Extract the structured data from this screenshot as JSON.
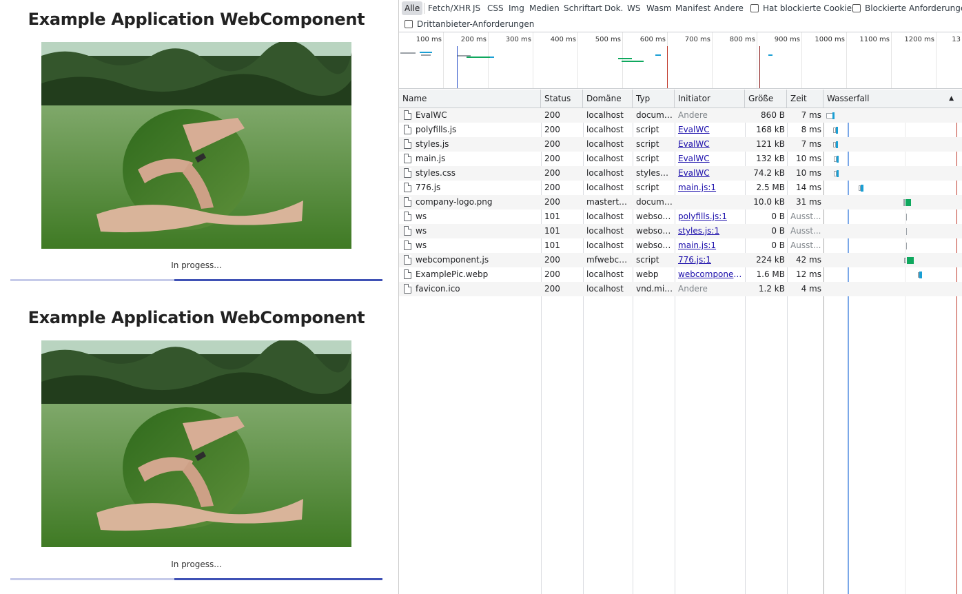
{
  "app_panels": [
    {
      "title": "Example Application WebComponent",
      "status": "In progess...",
      "progress": 0.44
    },
    {
      "title": "Example Application WebComponent",
      "status": "In progess...",
      "progress": 0.44
    }
  ],
  "filters": {
    "buttons": [
      "Alle",
      "Fetch/XHR",
      "JS",
      "CSS",
      "Img",
      "Medien",
      "Schriftart",
      "Dok.",
      "WS",
      "Wasm",
      "Manifest",
      "Andere"
    ],
    "active": "Alle",
    "checkboxes": [
      "Hat blockierte Cookies",
      "Blockierte Anforderungen",
      "Drittanbieter-Anforderungen"
    ]
  },
  "timeline": {
    "ticks": [
      "100 ms",
      "200 ms",
      "300 ms",
      "400 ms",
      "500 ms",
      "600 ms",
      "700 ms",
      "800 ms",
      "900 ms",
      "1000 ms",
      "1100 ms",
      "1200 ms",
      "13"
    ]
  },
  "columns": {
    "name": "Name",
    "status": "Status",
    "domain": "Domäne",
    "type": "Typ",
    "initiator": "Initiator",
    "size": "Größe",
    "time": "Zeit",
    "waterfall": "Wasserfall",
    "sort_icon": "▲"
  },
  "requests": [
    {
      "name": "EvalWC",
      "status": "200",
      "domain": "localhost",
      "type": "docume...",
      "initiator": "Andere",
      "initiator_link": false,
      "size": "860 B",
      "time": "7 ms",
      "icon": "document-icon"
    },
    {
      "name": "polyfills.js",
      "status": "200",
      "domain": "localhost",
      "type": "script",
      "initiator": "EvalWC",
      "initiator_link": true,
      "size": "168 kB",
      "time": "8 ms",
      "icon": "file-icon"
    },
    {
      "name": "styles.js",
      "status": "200",
      "domain": "localhost",
      "type": "script",
      "initiator": "EvalWC",
      "initiator_link": true,
      "size": "121 kB",
      "time": "7 ms",
      "icon": "file-icon"
    },
    {
      "name": "main.js",
      "status": "200",
      "domain": "localhost",
      "type": "script",
      "initiator": "EvalWC",
      "initiator_link": true,
      "size": "132 kB",
      "time": "10 ms",
      "icon": "file-icon"
    },
    {
      "name": "styles.css",
      "status": "200",
      "domain": "localhost",
      "type": "styleshe...",
      "initiator": "EvalWC",
      "initiator_link": true,
      "size": "74.2 kB",
      "time": "10 ms",
      "icon": "file-icon"
    },
    {
      "name": "776.js",
      "status": "200",
      "domain": "localhost",
      "type": "script",
      "initiator": "main.js:1",
      "initiator_link": true,
      "size": "2.5 MB",
      "time": "14 ms",
      "icon": "file-icon"
    },
    {
      "name": "company-logo.png",
      "status": "200",
      "domain": "masterthe...",
      "type": "docume...",
      "initiator": "",
      "initiator_link": false,
      "size": "10.0 kB",
      "time": "31 ms",
      "icon": "file-icon"
    },
    {
      "name": "ws",
      "status": "101",
      "domain": "localhost",
      "type": "websoc...",
      "initiator": "polyfills.js:1",
      "initiator_link": true,
      "size": "0 B",
      "time": "Ausst...",
      "icon": "file-icon"
    },
    {
      "name": "ws",
      "status": "101",
      "domain": "localhost",
      "type": "websoc...",
      "initiator": "styles.js:1",
      "initiator_link": true,
      "size": "0 B",
      "time": "Ausst...",
      "icon": "file-icon"
    },
    {
      "name": "ws",
      "status": "101",
      "domain": "localhost",
      "type": "websoc...",
      "initiator": "main.js:1",
      "initiator_link": true,
      "size": "0 B",
      "time": "Ausst...",
      "icon": "file-icon"
    },
    {
      "name": "webcomponent.js",
      "status": "200",
      "domain": "mfwebco...",
      "type": "script",
      "initiator": "776.js:1",
      "initiator_link": true,
      "size": "224 kB",
      "time": "42 ms",
      "icon": "file-icon"
    },
    {
      "name": "ExamplePic.webp",
      "status": "200",
      "domain": "localhost",
      "type": "webp",
      "initiator": "webcomponent...",
      "initiator_link": true,
      "size": "1.6 MB",
      "time": "12 ms",
      "icon": "image-file-icon"
    },
    {
      "name": "favicon.ico",
      "status": "200",
      "domain": "localhost",
      "type": "vnd.mic...",
      "initiator": "Andere",
      "initiator_link": false,
      "size": "1.2 kB",
      "time": "4 ms",
      "icon": "file-icon"
    }
  ],
  "colors": {
    "accent": "#3f51b5",
    "progress_track": "#c5cae9",
    "waterfall_download": "#1a9fd4",
    "waterfall_waiting": "#0fa85e",
    "dom_content_line": "#2b50c9",
    "load_line": "#c0392b"
  }
}
